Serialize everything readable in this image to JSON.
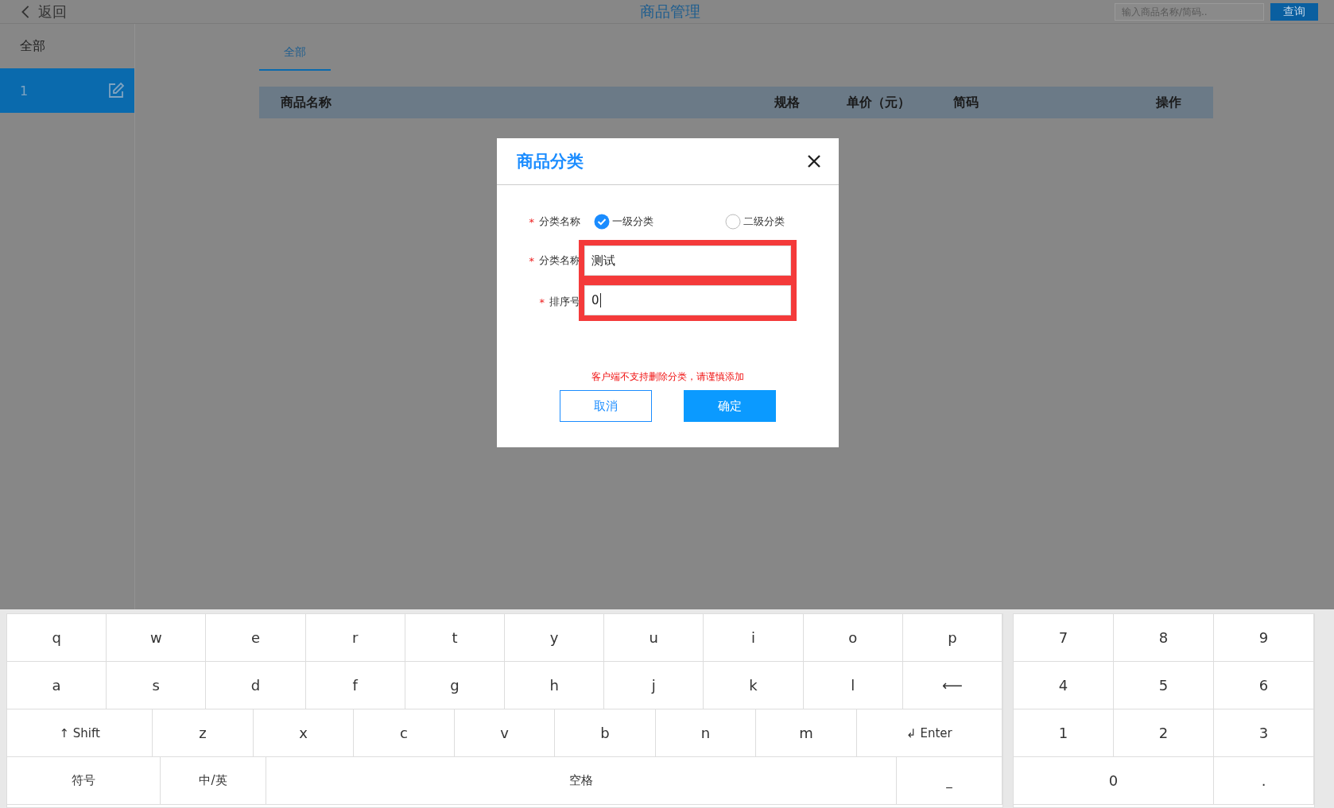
{
  "header": {
    "back_label": "返回",
    "title": "商品管理",
    "search": {
      "placeholder": "输入商品名称/简码.."
    },
    "search_button": "查询"
  },
  "sidebar": {
    "items": [
      {
        "label": "全部",
        "selected": false,
        "editable": false
      },
      {
        "label": "1",
        "selected": true,
        "editable": true
      }
    ]
  },
  "tabs": [
    {
      "label": "全部",
      "selected": true
    }
  ],
  "table": {
    "columns": [
      "商品名称",
      "规格",
      "单价（元）",
      "简码",
      "操作"
    ]
  },
  "dialog": {
    "title": "商品分类",
    "fields": [
      {
        "kind": "radio",
        "required_mark": "*",
        "label": "分类名称",
        "options": [
          {
            "label": "一级分类",
            "selected": true
          },
          {
            "label": "二级分类",
            "selected": false
          }
        ]
      },
      {
        "kind": "text",
        "required_mark": "*",
        "label": "分类名称",
        "value": "测试",
        "highlighted": true,
        "focused": false
      },
      {
        "kind": "text",
        "required_mark": "*",
        "label": "排序号",
        "value": "0",
        "highlighted": true,
        "focused": true
      }
    ],
    "warning": "客户端不支持删除分类，请谨慎添加",
    "buttons": [
      {
        "label": "取消",
        "kind": "secondary"
      },
      {
        "label": "确定",
        "kind": "primary"
      }
    ]
  },
  "keyboard": {
    "rows": [
      [
        {
          "label": "q",
          "kind": "normal"
        },
        {
          "label": "w",
          "kind": "normal"
        },
        {
          "label": "e",
          "kind": "normal"
        },
        {
          "label": "r",
          "kind": "normal"
        },
        {
          "label": "t",
          "kind": "normal"
        },
        {
          "label": "y",
          "kind": "normal"
        },
        {
          "label": "u",
          "kind": "normal"
        },
        {
          "label": "i",
          "kind": "normal"
        },
        {
          "label": "o",
          "kind": "normal"
        },
        {
          "label": "p",
          "kind": "normal"
        }
      ],
      [
        {
          "label": "a",
          "kind": "normal"
        },
        {
          "label": "s",
          "kind": "normal"
        },
        {
          "label": "d",
          "kind": "normal"
        },
        {
          "label": "f",
          "kind": "normal"
        },
        {
          "label": "g",
          "kind": "normal"
        },
        {
          "label": "h",
          "kind": "normal"
        },
        {
          "label": "j",
          "kind": "normal"
        },
        {
          "label": "k",
          "kind": "normal"
        },
        {
          "label": "l",
          "kind": "normal"
        },
        {
          "label": "⟵",
          "kind": "normal"
        }
      ],
      [
        {
          "label": "↑ Shift",
          "kind": "wide"
        },
        {
          "label": "z",
          "kind": "normal"
        },
        {
          "label": "x",
          "kind": "normal"
        },
        {
          "label": "c",
          "kind": "normal"
        },
        {
          "label": "v",
          "kind": "normal"
        },
        {
          "label": "b",
          "kind": "normal"
        },
        {
          "label": "n",
          "kind": "normal"
        },
        {
          "label": "m",
          "kind": "normal"
        },
        {
          "label": "↲ Enter",
          "kind": "wide"
        }
      ],
      [
        {
          "label": "符号",
          "kind": "wide"
        },
        {
          "label": "中/英",
          "kind": "normal"
        },
        {
          "label": "空格",
          "kind": "space"
        },
        {
          "label": "_",
          "kind": "normal"
        }
      ]
    ],
    "numpad": [
      {
        "label": "7",
        "kind": "normal"
      },
      {
        "label": "8",
        "kind": "normal"
      },
      {
        "label": "9",
        "kind": "normal"
      },
      {
        "label": "4",
        "kind": "normal"
      },
      {
        "label": "5",
        "kind": "normal"
      },
      {
        "label": "6",
        "kind": "normal"
      },
      {
        "label": "1",
        "kind": "normal"
      },
      {
        "label": "2",
        "kind": "normal"
      },
      {
        "label": "3",
        "kind": "normal"
      },
      {
        "label": "0",
        "kind": "wide"
      },
      {
        "label": ".",
        "kind": "normal"
      }
    ]
  }
}
